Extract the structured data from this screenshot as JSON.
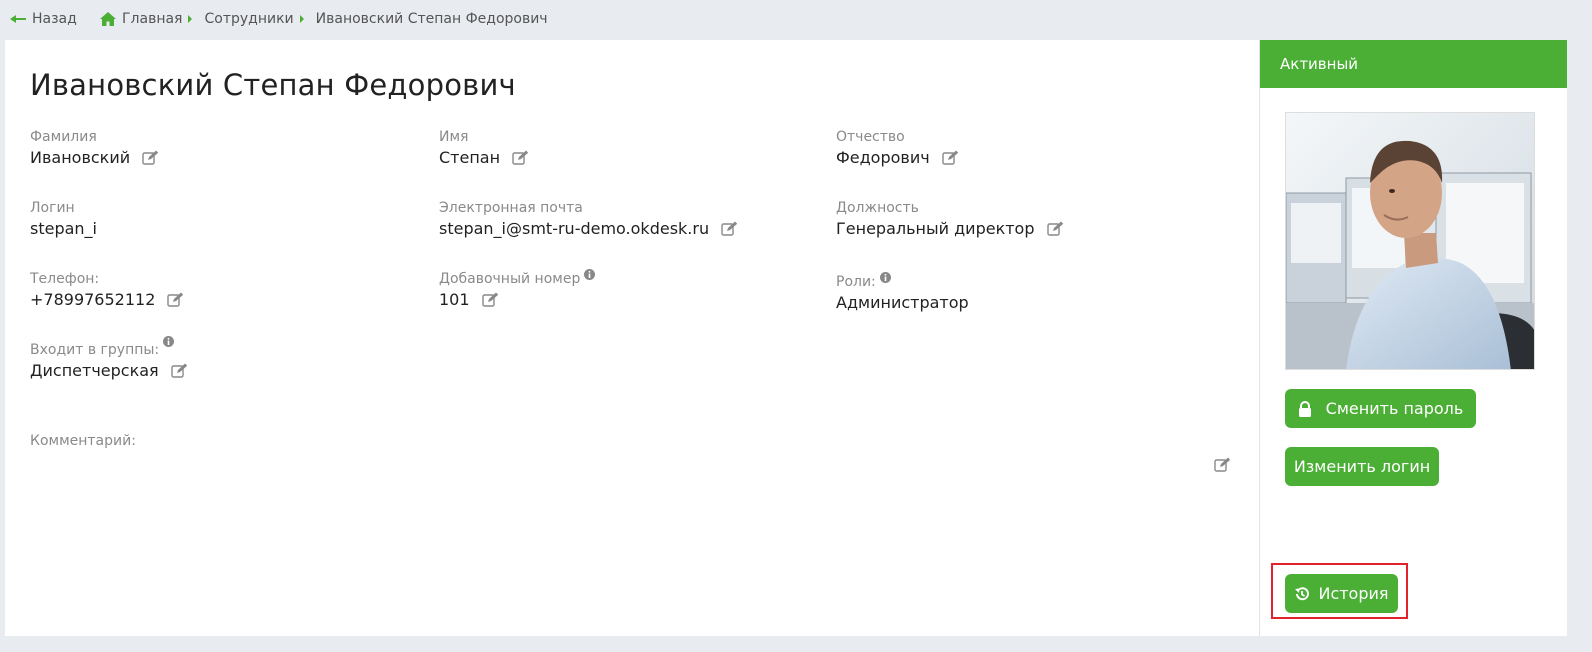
{
  "topbar": {
    "back_label": "Назад",
    "breadcrumbs": [
      "Главная",
      "Сотрудники",
      "Ивановский Степан Федорович"
    ]
  },
  "employee": {
    "full_name": "Ивановский Степан Федорович",
    "fields": {
      "last_name": {
        "label": "Фамилия",
        "value": "Ивановский"
      },
      "first_name": {
        "label": "Имя",
        "value": "Степан"
      },
      "middle_name": {
        "label": "Отчество",
        "value": "Федорович"
      },
      "login": {
        "label": "Логин",
        "value": "stepan_i"
      },
      "email": {
        "label": "Электронная почта",
        "value": "stepan_i@smt-ru-demo.okdesk.ru"
      },
      "position": {
        "label": "Должность",
        "value": "Генеральный директор"
      },
      "phone": {
        "label": "Телефон:",
        "value": "+78997652112"
      },
      "extension": {
        "label": "Добавочный номер",
        "value": "101"
      },
      "roles": {
        "label": "Роли:",
        "value": "Администратор"
      },
      "groups": {
        "label": "Входит в группы:",
        "value": "Диспетчерская"
      },
      "comment": {
        "label": "Комментарий:",
        "value": ""
      }
    }
  },
  "sidebar": {
    "status": "Активный",
    "change_password_label": "Сменить пароль",
    "change_login_label": "Изменить логин",
    "history_label": "История"
  },
  "colors": {
    "accent": "#4caf35",
    "highlight": "#e3232b"
  }
}
